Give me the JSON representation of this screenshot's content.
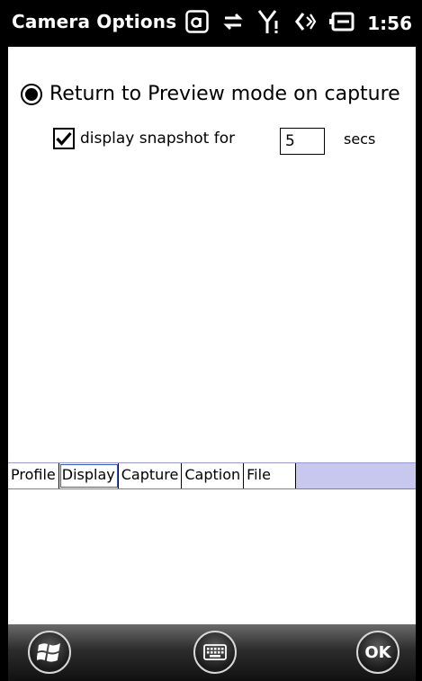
{
  "title_bar": {
    "title": "Camera Options",
    "time": "1:56",
    "status_icons": [
      "a-icon",
      "data-sync-icon",
      "signal-icon",
      "speaker-icon",
      "battery-icon"
    ]
  },
  "display_options": {
    "radio_label": "Return to Preview mode on capture",
    "radio_selected": true,
    "checkbox_label": "display snapshot for",
    "checkbox_checked": true,
    "snapshot_seconds": "5",
    "seconds_unit": "secs"
  },
  "tabs": [
    {
      "label": "Profile",
      "active": false
    },
    {
      "label": "Display",
      "active": true
    },
    {
      "label": "Capture",
      "active": false
    },
    {
      "label": "Caption",
      "active": false
    },
    {
      "label": "File",
      "active": false
    }
  ],
  "soft_keys": {
    "ok_label": "OK"
  },
  "colors": {
    "tab_strip_bg": "#c8c8ee",
    "title_bar_bg": "#000000",
    "active_tab_outline": "#3b5bb5"
  }
}
